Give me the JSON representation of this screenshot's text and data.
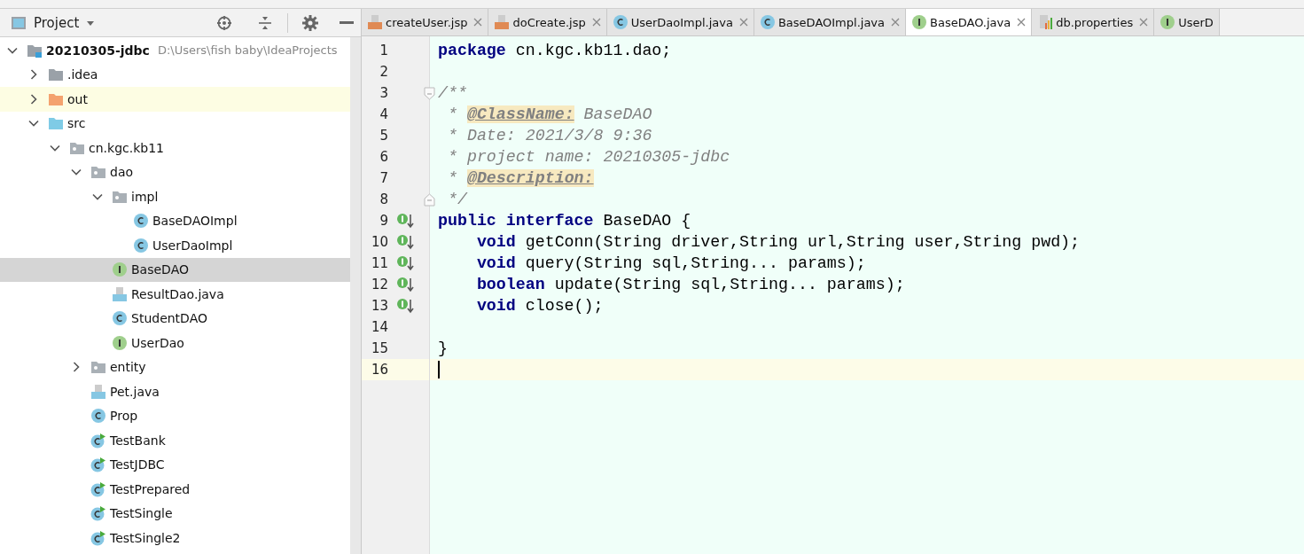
{
  "project_panel": {
    "title": "Project",
    "tree": [
      {
        "kind": "module",
        "name": "20210305-jdbc",
        "path": "D:\\Users\\fish baby\\IdeaProjects",
        "expanded": true,
        "selected": false,
        "children": [
          {
            "kind": "folder",
            "name": ".idea",
            "expanded": false,
            "selected": false
          },
          {
            "kind": "excluded-folder",
            "name": "out",
            "expanded": false,
            "selected": false
          },
          {
            "kind": "source-folder",
            "name": "src",
            "expanded": true,
            "selected": false,
            "children": [
              {
                "kind": "package",
                "name": "cn.kgc.kb11",
                "expanded": true,
                "selected": false,
                "children": [
                  {
                    "kind": "package",
                    "name": "dao",
                    "expanded": true,
                    "selected": false,
                    "children": [
                      {
                        "kind": "package",
                        "name": "impl",
                        "expanded": true,
                        "selected": false,
                        "children": [
                          {
                            "kind": "class",
                            "name": "BaseDAOImpl",
                            "selected": false
                          },
                          {
                            "kind": "class",
                            "name": "UserDaoImpl",
                            "selected": false
                          }
                        ]
                      },
                      {
                        "kind": "interface",
                        "name": "BaseDAO",
                        "selected": true
                      },
                      {
                        "kind": "java-file",
                        "name": "ResultDao.java",
                        "selected": false
                      },
                      {
                        "kind": "class",
                        "name": "StudentDAO",
                        "selected": false
                      },
                      {
                        "kind": "interface",
                        "name": "UserDao",
                        "selected": false
                      }
                    ]
                  },
                  {
                    "kind": "package",
                    "name": "entity",
                    "expanded": false,
                    "selected": false
                  },
                  {
                    "kind": "java-file",
                    "name": "Pet.java",
                    "selected": false
                  },
                  {
                    "kind": "class",
                    "name": "Prop",
                    "selected": false
                  },
                  {
                    "kind": "runnable-class",
                    "name": "TestBank",
                    "selected": false
                  },
                  {
                    "kind": "runnable-class",
                    "name": "TestJDBC",
                    "selected": false
                  },
                  {
                    "kind": "runnable-class",
                    "name": "TestPrepared",
                    "selected": false
                  },
                  {
                    "kind": "runnable-class",
                    "name": "TestSingle",
                    "selected": false
                  },
                  {
                    "kind": "runnable-class",
                    "name": "TestSingle2",
                    "selected": false
                  }
                ]
              }
            ]
          }
        ]
      }
    ]
  },
  "editor": {
    "tabs": [
      {
        "kind": "jsp",
        "label": "createUser.jsp",
        "selected": false,
        "closable": true
      },
      {
        "kind": "jsp",
        "label": "doCreate.jsp",
        "selected": false,
        "closable": true
      },
      {
        "kind": "class",
        "label": "UserDaoImpl.java",
        "selected": false,
        "closable": true
      },
      {
        "kind": "class",
        "label": "BaseDAOImpl.java",
        "selected": false,
        "closable": true
      },
      {
        "kind": "interface",
        "label": "BaseDAO.java",
        "selected": true,
        "closable": true
      },
      {
        "kind": "properties",
        "label": "db.properties",
        "selected": false,
        "closable": true
      },
      {
        "kind": "interface",
        "label": "UserD",
        "selected": false,
        "closable": false
      }
    ],
    "lines": [
      {
        "number": "1",
        "tokens": [
          {
            "kind": "keyword",
            "text": "package"
          },
          {
            "kind": "plain",
            "text": " cn.kgc.kb11.dao;"
          }
        ]
      },
      {
        "number": "2"
      },
      {
        "number": "3",
        "fold_start": true,
        "tokens": [
          {
            "kind": "comment",
            "text": "/**"
          }
        ]
      },
      {
        "number": "4",
        "tokens": [
          {
            "kind": "comment",
            "text": " * "
          },
          {
            "kind": "tag",
            "text": "@ClassName:"
          },
          {
            "kind": "comment",
            "text": " BaseDAO"
          }
        ]
      },
      {
        "number": "5",
        "tokens": [
          {
            "kind": "comment",
            "text": " * Date: 2021/3/8 9:36"
          }
        ]
      },
      {
        "number": "6",
        "tokens": [
          {
            "kind": "comment",
            "text": " * project name: 20210305-jdbc"
          }
        ]
      },
      {
        "number": "7",
        "tokens": [
          {
            "kind": "comment",
            "text": " * "
          },
          {
            "kind": "tag",
            "text": "@Description:"
          }
        ]
      },
      {
        "number": "8",
        "fold_end": true,
        "tokens": [
          {
            "kind": "comment",
            "text": " */"
          }
        ]
      },
      {
        "number": "9",
        "implemented": true,
        "tokens": [
          {
            "kind": "keyword",
            "text": "public interface"
          },
          {
            "kind": "plain",
            "text": " BaseDAO {"
          }
        ]
      },
      {
        "number": "10",
        "implemented": true,
        "tokens": [
          {
            "kind": "keyword",
            "text": "    void"
          },
          {
            "kind": "plain",
            "text": " getConn(String driver,String url,String user,String pwd);"
          }
        ]
      },
      {
        "number": "11",
        "implemented": true,
        "tokens": [
          {
            "kind": "keyword",
            "text": "    void"
          },
          {
            "kind": "plain",
            "text": " query(String sql,String... params);"
          }
        ]
      },
      {
        "number": "12",
        "implemented": true,
        "tokens": [
          {
            "kind": "keyword",
            "text": "    boolean"
          },
          {
            "kind": "plain",
            "text": " update(String sql,String... params);"
          }
        ]
      },
      {
        "number": "13",
        "implemented": true,
        "tokens": [
          {
            "kind": "keyword",
            "text": "    void"
          },
          {
            "kind": "plain",
            "text": " close();"
          }
        ]
      },
      {
        "number": "14"
      },
      {
        "number": "15",
        "tokens": [
          {
            "kind": "plain",
            "text": "}"
          }
        ]
      },
      {
        "number": "16",
        "current": true
      }
    ]
  }
}
